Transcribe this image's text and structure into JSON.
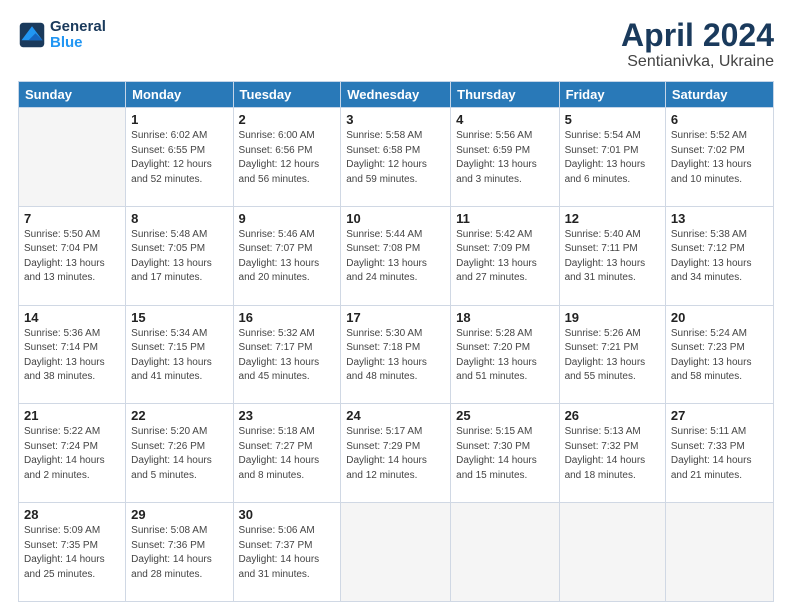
{
  "header": {
    "logo_line1": "General",
    "logo_line2": "Blue",
    "title": "April 2024",
    "subtitle": "Sentianivka, Ukraine"
  },
  "weekdays": [
    "Sunday",
    "Monday",
    "Tuesday",
    "Wednesday",
    "Thursday",
    "Friday",
    "Saturday"
  ],
  "weeks": [
    [
      {
        "day": null
      },
      {
        "day": 1,
        "sunrise": "6:02 AM",
        "sunset": "6:55 PM",
        "daylight": "12 hours and 52 minutes."
      },
      {
        "day": 2,
        "sunrise": "6:00 AM",
        "sunset": "6:56 PM",
        "daylight": "12 hours and 56 minutes."
      },
      {
        "day": 3,
        "sunrise": "5:58 AM",
        "sunset": "6:58 PM",
        "daylight": "12 hours and 59 minutes."
      },
      {
        "day": 4,
        "sunrise": "5:56 AM",
        "sunset": "6:59 PM",
        "daylight": "13 hours and 3 minutes."
      },
      {
        "day": 5,
        "sunrise": "5:54 AM",
        "sunset": "7:01 PM",
        "daylight": "13 hours and 6 minutes."
      },
      {
        "day": 6,
        "sunrise": "5:52 AM",
        "sunset": "7:02 PM",
        "daylight": "13 hours and 10 minutes."
      }
    ],
    [
      {
        "day": 7,
        "sunrise": "5:50 AM",
        "sunset": "7:04 PM",
        "daylight": "13 hours and 13 minutes."
      },
      {
        "day": 8,
        "sunrise": "5:48 AM",
        "sunset": "7:05 PM",
        "daylight": "13 hours and 17 minutes."
      },
      {
        "day": 9,
        "sunrise": "5:46 AM",
        "sunset": "7:07 PM",
        "daylight": "13 hours and 20 minutes."
      },
      {
        "day": 10,
        "sunrise": "5:44 AM",
        "sunset": "7:08 PM",
        "daylight": "13 hours and 24 minutes."
      },
      {
        "day": 11,
        "sunrise": "5:42 AM",
        "sunset": "7:09 PM",
        "daylight": "13 hours and 27 minutes."
      },
      {
        "day": 12,
        "sunrise": "5:40 AM",
        "sunset": "7:11 PM",
        "daylight": "13 hours and 31 minutes."
      },
      {
        "day": 13,
        "sunrise": "5:38 AM",
        "sunset": "7:12 PM",
        "daylight": "13 hours and 34 minutes."
      }
    ],
    [
      {
        "day": 14,
        "sunrise": "5:36 AM",
        "sunset": "7:14 PM",
        "daylight": "13 hours and 38 minutes."
      },
      {
        "day": 15,
        "sunrise": "5:34 AM",
        "sunset": "7:15 PM",
        "daylight": "13 hours and 41 minutes."
      },
      {
        "day": 16,
        "sunrise": "5:32 AM",
        "sunset": "7:17 PM",
        "daylight": "13 hours and 45 minutes."
      },
      {
        "day": 17,
        "sunrise": "5:30 AM",
        "sunset": "7:18 PM",
        "daylight": "13 hours and 48 minutes."
      },
      {
        "day": 18,
        "sunrise": "5:28 AM",
        "sunset": "7:20 PM",
        "daylight": "13 hours and 51 minutes."
      },
      {
        "day": 19,
        "sunrise": "5:26 AM",
        "sunset": "7:21 PM",
        "daylight": "13 hours and 55 minutes."
      },
      {
        "day": 20,
        "sunrise": "5:24 AM",
        "sunset": "7:23 PM",
        "daylight": "13 hours and 58 minutes."
      }
    ],
    [
      {
        "day": 21,
        "sunrise": "5:22 AM",
        "sunset": "7:24 PM",
        "daylight": "14 hours and 2 minutes."
      },
      {
        "day": 22,
        "sunrise": "5:20 AM",
        "sunset": "7:26 PM",
        "daylight": "14 hours and 5 minutes."
      },
      {
        "day": 23,
        "sunrise": "5:18 AM",
        "sunset": "7:27 PM",
        "daylight": "14 hours and 8 minutes."
      },
      {
        "day": 24,
        "sunrise": "5:17 AM",
        "sunset": "7:29 PM",
        "daylight": "14 hours and 12 minutes."
      },
      {
        "day": 25,
        "sunrise": "5:15 AM",
        "sunset": "7:30 PM",
        "daylight": "14 hours and 15 minutes."
      },
      {
        "day": 26,
        "sunrise": "5:13 AM",
        "sunset": "7:32 PM",
        "daylight": "14 hours and 18 minutes."
      },
      {
        "day": 27,
        "sunrise": "5:11 AM",
        "sunset": "7:33 PM",
        "daylight": "14 hours and 21 minutes."
      }
    ],
    [
      {
        "day": 28,
        "sunrise": "5:09 AM",
        "sunset": "7:35 PM",
        "daylight": "14 hours and 25 minutes."
      },
      {
        "day": 29,
        "sunrise": "5:08 AM",
        "sunset": "7:36 PM",
        "daylight": "14 hours and 28 minutes."
      },
      {
        "day": 30,
        "sunrise": "5:06 AM",
        "sunset": "7:37 PM",
        "daylight": "14 hours and 31 minutes."
      },
      {
        "day": null
      },
      {
        "day": null
      },
      {
        "day": null
      },
      {
        "day": null
      }
    ]
  ]
}
